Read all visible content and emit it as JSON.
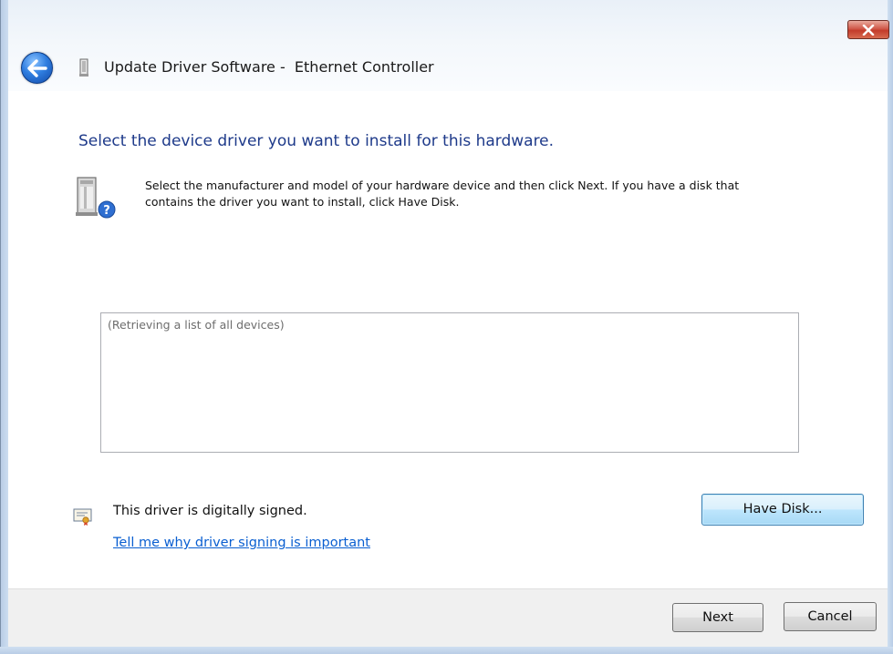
{
  "window": {
    "title": "Update Driver Software -  Ethernet Controller"
  },
  "content": {
    "heading": "Select the device driver you want to install for this hardware.",
    "instruction": "Select the manufacturer and model of your hardware device and then click Next. If you have a disk that contains the driver you want to install, click Have Disk.",
    "device_list_status": "(Retrieving a list of all devices)",
    "signed_text": "This driver is digitally signed.",
    "signing_link": "Tell me why driver signing is important",
    "have_disk_label": "Have Disk..."
  },
  "footer": {
    "next_label": "Next",
    "cancel_label": "Cancel"
  },
  "icons": {
    "close": "close-icon",
    "back": "back-arrow-icon",
    "device_small": "device-icon",
    "hardware_help": "hardware-help-icon",
    "certificate": "certificate-icon"
  },
  "colors": {
    "heading": "#1e3a8a",
    "link": "#0a5fd1",
    "close_button": "#c33b2a",
    "back_button": "#2f7ee0"
  }
}
